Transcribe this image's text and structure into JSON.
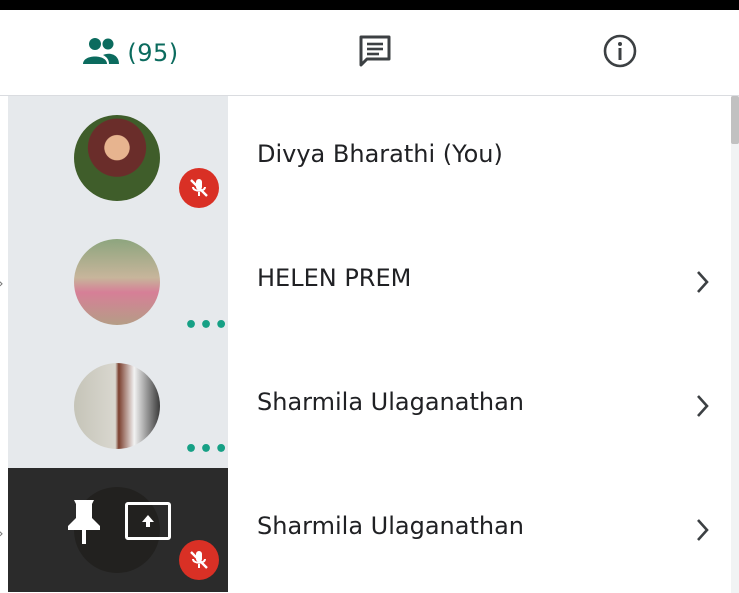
{
  "colors": {
    "accent": "#0b6b5e",
    "mute_red": "#d93025",
    "more_green": "#16a085"
  },
  "tabs": [
    {
      "icon": "people-icon",
      "count": "(95)",
      "selected": true
    },
    {
      "icon": "chat-icon"
    },
    {
      "icon": "info-icon"
    }
  ],
  "participants": [
    {
      "name": "Divya Bharathi (You)",
      "status": "muted",
      "has_chevron": false
    },
    {
      "name": "HELEN PREM",
      "status": "more-options",
      "has_chevron": true
    },
    {
      "name": "Sharmila Ulaganathan",
      "status": "more-options",
      "has_chevron": true
    },
    {
      "name": "Sharmila Ulaganathan",
      "status": "presenting-muted",
      "has_chevron": true,
      "icons": [
        "pin-icon",
        "present-to-all-icon"
      ]
    }
  ]
}
